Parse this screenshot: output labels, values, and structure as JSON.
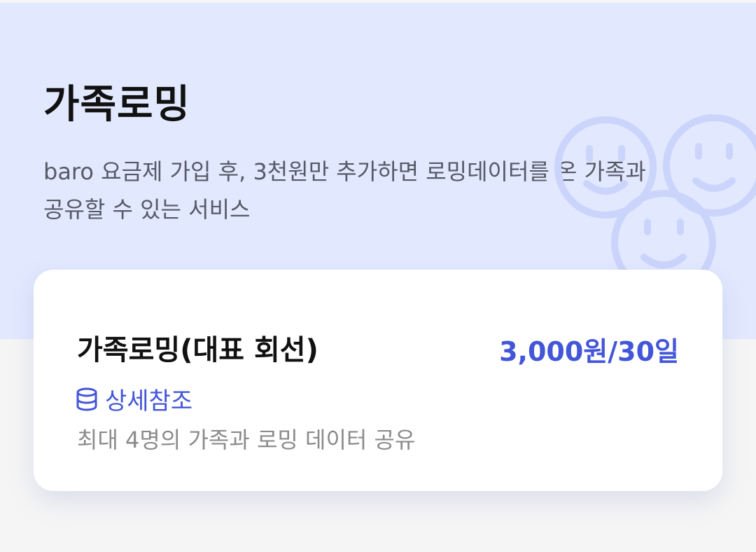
{
  "hero": {
    "title": "가족로밍",
    "description": "baro 요금제 가입 후, 3천원만 추가하면 로밍데이터를 온 가족과 공유할 수 있는 서비스",
    "illustration_icon": "smiley-faces-icon"
  },
  "plan": {
    "name": "가족로밍(대표 회선)",
    "price": "3,000원/30일",
    "detail_link_label": "상세참조",
    "detail_link_icon": "database-icon",
    "description": "최대 4명의 가족과 로밍 데이터 공유"
  },
  "colors": {
    "accent": "#4356d9",
    "hero_bg": "#e2e8fe",
    "page_bg": "#f5f5f5"
  }
}
